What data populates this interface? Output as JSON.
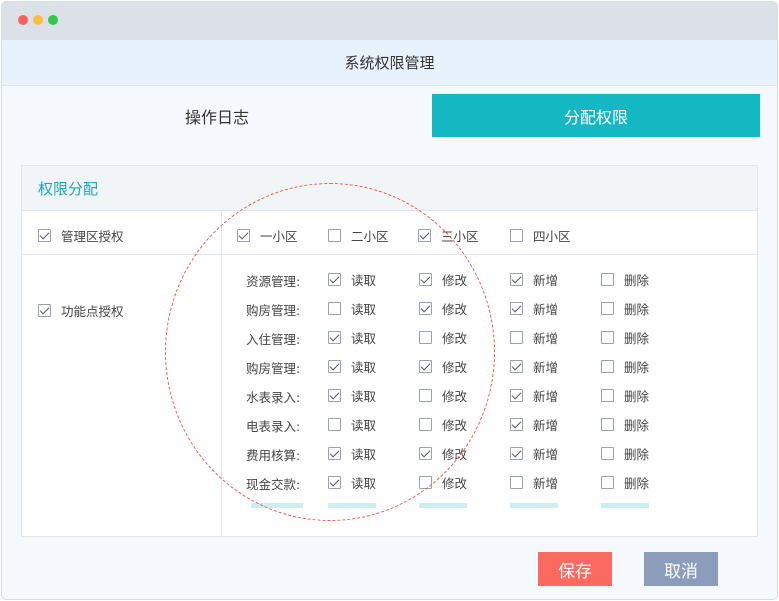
{
  "header": {
    "title": "系统权限管理"
  },
  "tabs": {
    "log": "操作日志",
    "assign": "分配权限"
  },
  "panel": {
    "title": "权限分配"
  },
  "admin_auth": {
    "label": "管理区授权",
    "checked": true
  },
  "function_auth": {
    "label": "功能点授权",
    "checked": true
  },
  "zones": [
    {
      "label": "一小区",
      "checked": true
    },
    {
      "label": "二小区",
      "checked": false
    },
    {
      "label": "三小区",
      "checked": true
    },
    {
      "label": "四小区",
      "checked": false
    }
  ],
  "perm_labels": [
    "读取",
    "修改",
    "新增",
    "删除"
  ],
  "functions": [
    {
      "name": "资源管理:",
      "read": true,
      "edit": true,
      "add": true,
      "del": false
    },
    {
      "name": "购房管理:",
      "read": false,
      "edit": true,
      "add": true,
      "del": false
    },
    {
      "name": "入住管理:",
      "read": true,
      "edit": false,
      "add": false,
      "del": false
    },
    {
      "name": "购房管理:",
      "read": true,
      "edit": true,
      "add": true,
      "del": false
    },
    {
      "name": "水表录入:",
      "read": true,
      "edit": false,
      "add": true,
      "del": false
    },
    {
      "name": "电表录入:",
      "read": false,
      "edit": false,
      "add": true,
      "del": false
    },
    {
      "name": "费用核算:",
      "read": true,
      "edit": true,
      "add": true,
      "del": false
    },
    {
      "name": "现金交款:",
      "read": true,
      "edit": false,
      "add": false,
      "del": false
    }
  ],
  "buttons": {
    "save": "保存",
    "cancel": "取消"
  },
  "colors": {
    "accent": "#14b8c3",
    "save": "#fb6a5e",
    "cancel": "#8b9dbb",
    "annotation": "#f0554f"
  }
}
